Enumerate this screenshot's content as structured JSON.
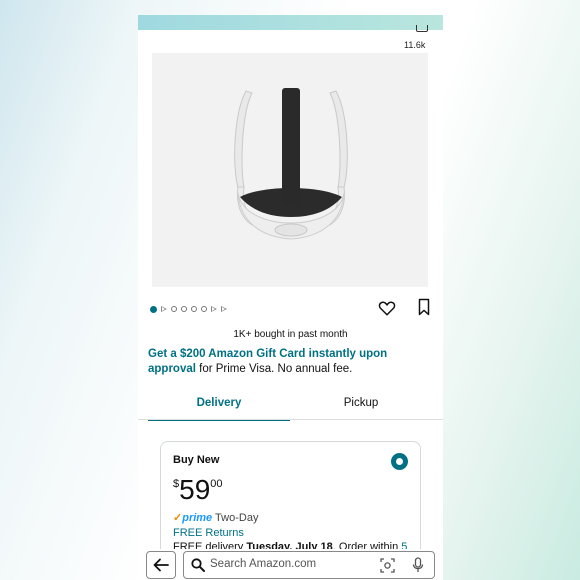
{
  "header": {
    "share_count": "11.6k"
  },
  "product": {
    "image_icon": "vr-head-strap-image",
    "carousel": {
      "total": 8,
      "active_index": 0
    }
  },
  "social_proof": {
    "bought_text": "1K+ bought in past month"
  },
  "promo": {
    "link_text": "Get a $200 Amazon Gift Card instantly upon approval",
    "rest_text": " for Prime Visa. No annual fee."
  },
  "tabs": [
    {
      "label": "Delivery",
      "selected": true
    },
    {
      "label": "Pickup",
      "selected": false
    }
  ],
  "offer": {
    "title": "Buy New",
    "price_symbol": "$",
    "price_whole": "59",
    "price_fraction": "00",
    "prime_check": "✓",
    "prime_label": "prime",
    "prime_speed": "Two-Day",
    "free_returns": "FREE Returns",
    "delivery_prefix": "FREE delivery ",
    "delivery_date": "Tuesday, July 18",
    "delivery_suffix": ". Order within ",
    "delivery_time": "5"
  },
  "search": {
    "placeholder": "Search Amazon.com"
  },
  "colors": {
    "accent": "#007185",
    "prime_blue": "#1a98ff",
    "prime_orange": "#f08804"
  }
}
